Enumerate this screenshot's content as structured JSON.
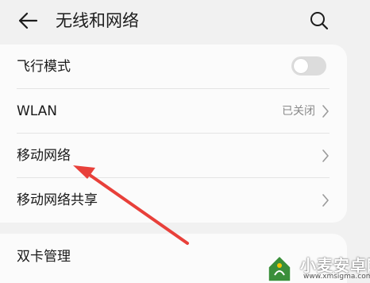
{
  "header": {
    "back_icon": "arrow-left-icon",
    "title": "无线和网络",
    "search_icon": "search-icon"
  },
  "settings": {
    "airplane_mode": {
      "label": "飞行模式",
      "enabled": false
    },
    "wlan": {
      "label": "WLAN",
      "status": "已关闭"
    },
    "mobile_network": {
      "label": "移动网络"
    },
    "mobile_hotspot": {
      "label": "移动网络共享"
    },
    "dual_sim": {
      "label": "双卡管理"
    }
  },
  "annotation": {
    "arrow_color": "#e8403a"
  },
  "watermark": {
    "title": "小麦安卓网",
    "url": "www.xmsigma.com"
  },
  "colors": {
    "background": "#f1f1f1",
    "card": "#fbfbfb",
    "secondary_text": "#8a8a8a"
  }
}
